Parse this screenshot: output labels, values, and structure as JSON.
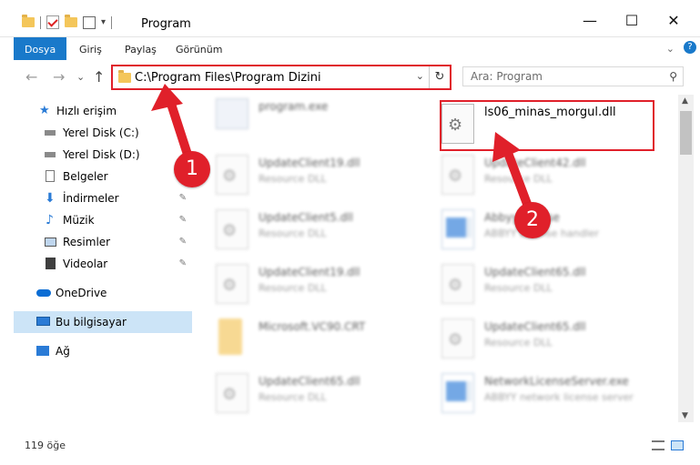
{
  "window": {
    "title": "Program",
    "minimize": "—",
    "maximize": "☐",
    "close": "✕"
  },
  "ribbon": {
    "tabs": [
      "Dosya",
      "Giriş",
      "Paylaş",
      "Görünüm"
    ],
    "expand": "⌄",
    "help": "?"
  },
  "nav": {
    "back": "←",
    "forward": "→",
    "recent": "⌄",
    "up": "↑"
  },
  "address": {
    "path": "C:\\Program Files\\Program Dizini",
    "dropdown": "⌄",
    "refresh": "↻"
  },
  "search": {
    "placeholder": "Ara: Program",
    "icon": "search-icon"
  },
  "sidebar": {
    "items": [
      {
        "label": "Hızlı erişim",
        "icon": "star-icon",
        "color": "#2a7bd6"
      },
      {
        "label": "Yerel Disk (C:)",
        "icon": "drive-icon",
        "color": "#6d6d6d"
      },
      {
        "label": "Yerel Disk (D:)",
        "icon": "drive-icon",
        "color": "#6d6d6d"
      },
      {
        "label": "Belgeler",
        "icon": "document-icon",
        "color": "#6d6d6d"
      },
      {
        "label": "İndirmeler",
        "icon": "download-icon",
        "color": "#2a7bd6"
      },
      {
        "label": "Müzik",
        "icon": "music-icon",
        "color": "#2a7bd6"
      },
      {
        "label": "Resimler",
        "icon": "picture-icon",
        "color": "#4a4a4a"
      },
      {
        "label": "Videolar",
        "icon": "video-icon",
        "color": "#4a4a4a"
      },
      {
        "label": "OneDrive",
        "icon": "cloud-icon",
        "color": "#0b6dd4"
      },
      {
        "label": "Bu bilgisayar",
        "icon": "computer-icon",
        "color": "#2a7bd6"
      },
      {
        "label": "Ağ",
        "icon": "network-icon",
        "color": "#2a7bd6"
      }
    ],
    "pin_glyph": "📌"
  },
  "files": {
    "left": [
      {
        "name": "program.exe",
        "type": "",
        "icon": "exe-icon"
      },
      {
        "name": "UpdateClient19.dll",
        "type": "Resource DLL",
        "icon": "dll-icon"
      },
      {
        "name": "UpdateClient5.dll",
        "type": "Resource DLL",
        "icon": "dll-icon"
      },
      {
        "name": "UpdateClient19.dll",
        "type": "Resource DLL",
        "icon": "dll-icon"
      },
      {
        "name": "Microsoft.VC90.CRT",
        "type": "",
        "icon": "folder-icon"
      },
      {
        "name": "UpdateClient65.dll",
        "type": "Resource DLL",
        "icon": "dll-icon"
      }
    ],
    "right": [
      {
        "name": "ls06_minas_morgul.dll",
        "type": "",
        "icon": "dll-icon"
      },
      {
        "name": "UpdateClient42.dll",
        "type": "Resource DLL",
        "icon": "dll-icon"
      },
      {
        "name": "AbbyyLicense",
        "type": "ABBYY License handler",
        "icon": "app-icon"
      },
      {
        "name": "UpdateClient65.dll",
        "type": "Resource DLL",
        "icon": "dll-icon"
      },
      {
        "name": "UpdateClient65.dll",
        "type": "Resource DLL",
        "icon": "dll-icon"
      },
      {
        "name": "NetworkLicenseServer.exe",
        "type": "ABBYY network license server",
        "icon": "app-icon"
      }
    ]
  },
  "annotations": {
    "badge1": "1",
    "badge2": "2",
    "color": "#e0202a"
  },
  "status": {
    "count": "119 öğe"
  }
}
